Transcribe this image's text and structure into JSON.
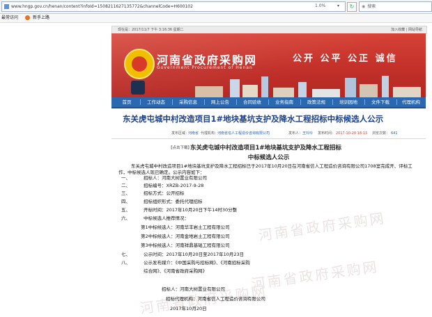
{
  "browser": {
    "url": "www.hngp.gov.cn/henan/content?infoId=1508211627135772&channelCode=H600102",
    "zoom_label": "1.0%",
    "search_placeholder": "搜索",
    "bookmarks": [
      "最常访问",
      "新手上路"
    ]
  },
  "site": {
    "date_line": "现在是：2017/11/7 下午 3:16:36 星期二",
    "top_links": "加入收藏 | 网站导航",
    "title": "河南省政府采购网",
    "subtitle": "Government Procurement of Henan",
    "slogan": "公开 公平 公正 诚信",
    "nav": [
      "首页",
      "工作动态",
      "采购信息",
      "网上公告",
      "合同验收",
      "业务指南",
      "政策法规",
      "培训园地",
      "文件下载",
      "代理机构"
    ]
  },
  "article": {
    "heading": "东关虎屯城中村改造项目1#地块基坑支护及降水工程招标中标候选人公示",
    "meta_region": "发布区域：",
    "meta_region_val": "河南省",
    "meta_agency": "代理机构：",
    "meta_agency_val": "河南省信人工程造价咨询有限公司",
    "meta_author": "发布人：",
    "meta_author_val": "王玲玲",
    "meta_time": "发布时间：",
    "meta_time_val": "2017-10-20 18:13",
    "meta_views": "浏览次数：",
    "meta_views_val": "641",
    "download_label": "【点击下载】",
    "content_title": "东关虎屯城中村改造项目1#地块基坑支护及降水工程招标",
    "content_title2": "中标候选人公示",
    "intro": "东关虎屯城中村改造项目1#地块基坑支护及降水工程招标已于2017年10月20日在河南省信人工程造价咨询有限公司1708室完成开、评标工作，中标候选人现已确定。公示内容如下：",
    "items": [
      {
        "num": "一、",
        "text": "招标人：河南大树置业有限公司"
      },
      {
        "num": "二、",
        "text": "招标编号：XRZB-2017-9-28"
      },
      {
        "num": "三、",
        "text": "招标方式：公开招标"
      },
      {
        "num": "四、",
        "text": "招标组织形式：委托代理招标"
      },
      {
        "num": "五、",
        "text": "开标时间：2017年10月20日下午14时30分整"
      },
      {
        "num": "六、",
        "text": "中标候选人推荐情况："
      }
    ],
    "candidates": [
      "第1中标候选人：河南华丰岩土工程有限公司",
      "第2中标候选人：河南金地岩土工程有限公司",
      "第3中标候选人：河南祥鼎基础工程有限公司"
    ],
    "item7_num": "七、",
    "item7": "公示时间：2017年10月20日至2017年10月23日",
    "item8_num": "八、",
    "item8": "公示发布媒介：《中国采购与招标网》、《河南招标采购",
    "item8b": "综合网》、《河南省政府采购网》",
    "sign_owner": "招标人：河南大树置业有限公司",
    "sign_agent": "招标代理机构：河南省信人工程造价咨询有限公司",
    "sign_date": "2017年10月20日",
    "watermark": "河南省政府采购网"
  }
}
